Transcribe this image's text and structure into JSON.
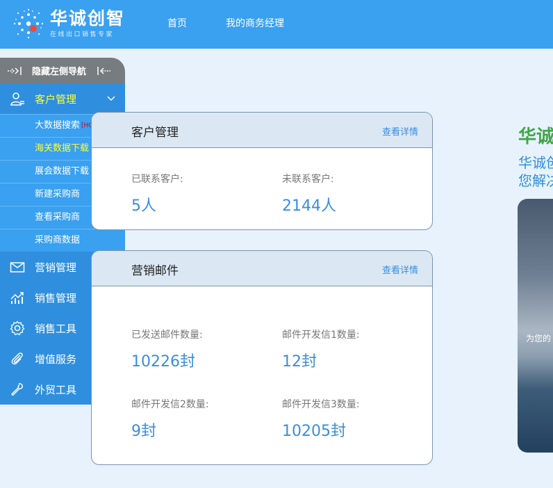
{
  "header": {
    "logo_title": "华诚创智",
    "logo_subtitle": "在线出口销售专家",
    "nav": [
      {
        "label": "首页"
      },
      {
        "label": "我的商务经理"
      }
    ]
  },
  "sidebar": {
    "hide_label": "隐藏左侧导航",
    "customer_mgmt": {
      "label": "客户管理",
      "icon": "user-list-icon",
      "expanded": true,
      "sub_items": [
        {
          "label": "大数据搜索",
          "badge": "[HOT]"
        },
        {
          "label": "海关数据下载",
          "selected": true
        },
        {
          "label": "展会数据下载"
        },
        {
          "label": "新建采购商"
        },
        {
          "label": "查看采购商"
        },
        {
          "label": "采购商数据"
        }
      ]
    },
    "menus": [
      {
        "label": "营销管理",
        "icon": "envelope-icon"
      },
      {
        "label": "销售管理",
        "icon": "chart-trend-icon"
      },
      {
        "label": "销售工具",
        "icon": "gear-icon"
      },
      {
        "label": "增值服务",
        "icon": "paperclip-icon"
      },
      {
        "label": "外贸工具",
        "icon": "wrench-icon"
      }
    ]
  },
  "cards": {
    "customer": {
      "title": "客户管理",
      "link": "查看详情",
      "stats": [
        {
          "label": "已联系客户:",
          "value": "5人"
        },
        {
          "label": "未联系客户:",
          "value": "2144人"
        }
      ]
    },
    "email": {
      "title": "营销邮件",
      "link": "查看详情",
      "stats": [
        {
          "label": "已发送邮件数量:",
          "value": "10226封"
        },
        {
          "label": "邮件开发信1数量:",
          "value": "12封"
        },
        {
          "label": "邮件开发信2数量:",
          "value": "9封"
        },
        {
          "label": "邮件开发信3数量:",
          "value": "10205封"
        }
      ]
    }
  },
  "right_panel": {
    "title": "华诚",
    "line1": "华诚创",
    "line2": "您解决",
    "banner_text": "为您的"
  },
  "colors": {
    "topbar": "#3aa0f0",
    "sidebar_main": "#2f8fde",
    "highlight_text": "#ffff33",
    "value_blue": "#3a8ddf",
    "green": "#41a548"
  }
}
